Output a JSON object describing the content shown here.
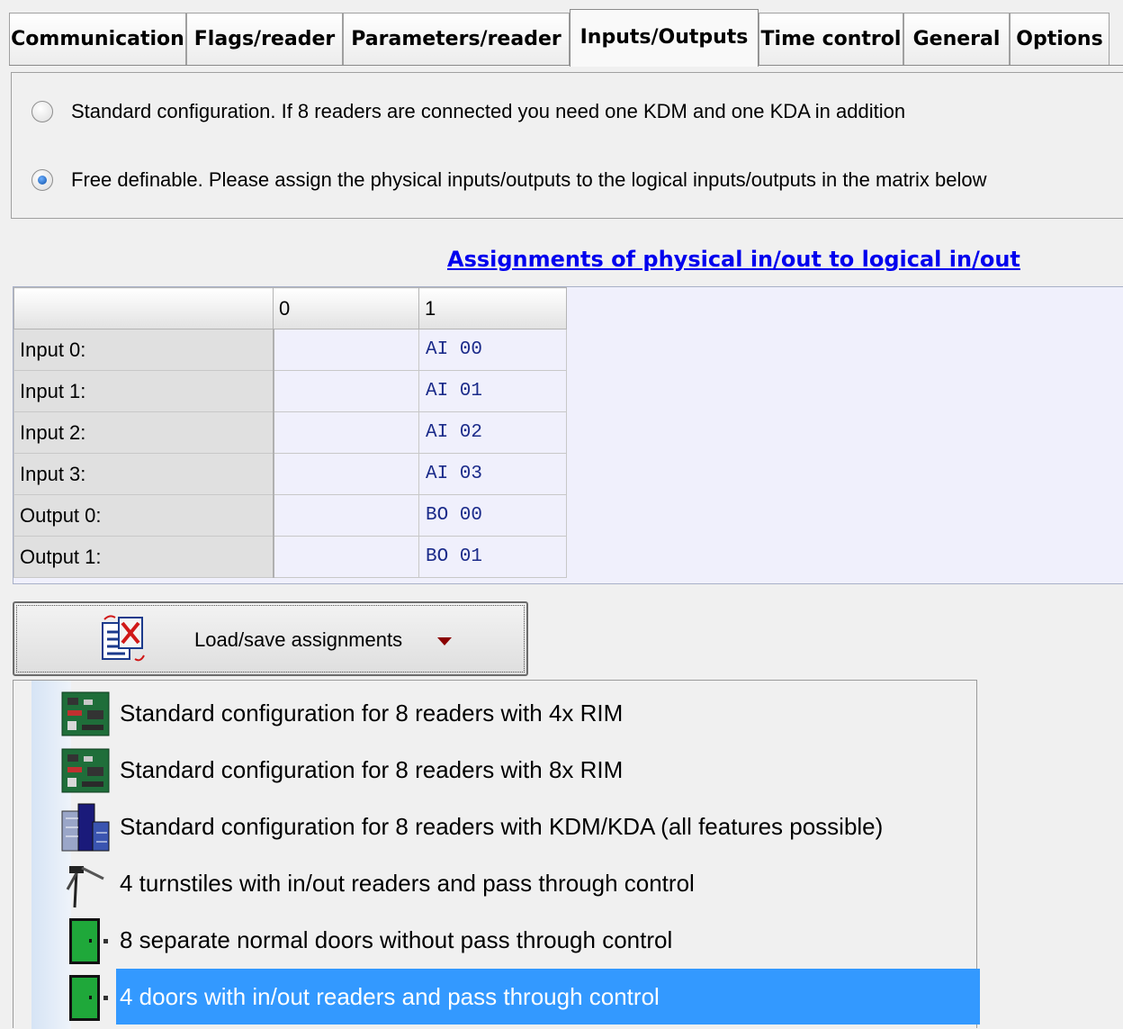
{
  "tabs": [
    {
      "label": "Communication",
      "active": false
    },
    {
      "label": "Flags/reader",
      "active": false
    },
    {
      "label": "Parameters/reader",
      "active": false
    },
    {
      "label": "Inputs/Outputs",
      "active": true
    },
    {
      "label": "Time control",
      "active": false
    },
    {
      "label": "General",
      "active": false
    },
    {
      "label": "Options",
      "active": false
    }
  ],
  "config_options": {
    "standard": {
      "label": "Standard configuration. If 8 readers are connected you need one KDM and one KDA in addition",
      "checked": false
    },
    "free": {
      "label": "Free definable. Please assign the physical inputs/outputs to the logical inputs/outputs in the matrix below",
      "checked": true
    }
  },
  "assignments_link": "Assignments of physical in/out to logical in/out ",
  "matrix": {
    "columns": [
      "",
      "0",
      "1"
    ],
    "rows": [
      {
        "label": "Input 0:",
        "col0": "",
        "col1": "AI 00"
      },
      {
        "label": "Input 1:",
        "col0": "",
        "col1": "AI 01"
      },
      {
        "label": "Input 2:",
        "col0": "",
        "col1": "AI 02"
      },
      {
        "label": "Input 3:",
        "col0": "",
        "col1": "AI 03"
      },
      {
        "label": "Output 0:",
        "col0": "",
        "col1": "BO 00"
      },
      {
        "label": "Output 1:",
        "col0": "",
        "col1": "BO 01"
      }
    ]
  },
  "load_save_button": {
    "label": "Load/save assignments",
    "icon": "document-transfer-icon"
  },
  "menu": {
    "items": [
      {
        "label": "Standard configuration for 8 readers with 4x RIM",
        "icon": "circuit-board-icon",
        "selected": false
      },
      {
        "label": "Standard configuration for 8 readers with 8x RIM",
        "icon": "circuit-board-icon",
        "selected": false
      },
      {
        "label": "Standard configuration for 8 readers with KDM/KDA (all features possible)",
        "icon": "building-icon",
        "selected": false
      },
      {
        "label": "4 turnstiles with in/out readers and pass through control",
        "icon": "turnstile-icon",
        "selected": false
      },
      {
        "label": "8 separate normal doors without pass through control",
        "icon": "green-door-icon",
        "selected": false
      },
      {
        "label": "4 doors with in/out readers and pass through control",
        "icon": "green-door-icon",
        "selected": true
      }
    ]
  },
  "colors": {
    "selection": "#3399ff",
    "link": "#0000ee",
    "matrix_bg": "#f0f0fc",
    "mono_text": "#1b2b8a"
  }
}
